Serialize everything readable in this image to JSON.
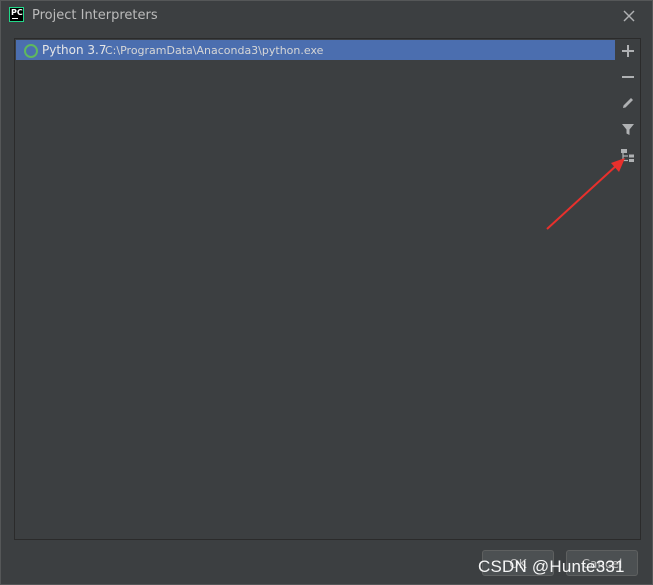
{
  "window": {
    "app_logo_text": "PC",
    "title": "Project Interpreters"
  },
  "interpreters": [
    {
      "name": "Python 3.7",
      "path": "C:\\ProgramData\\Anaconda3\\python.exe",
      "selected": true
    }
  ],
  "toolbar": {
    "icons": [
      "add-icon",
      "remove-icon",
      "edit-icon",
      "filter-icon",
      "show-paths-icon"
    ]
  },
  "footer": {
    "ok_label": "OK",
    "cancel_label": "Cancel"
  },
  "watermark": "CSDN @Hunte331",
  "colors": {
    "background": "#3c3f41",
    "selection": "#4b6eaf",
    "ring": "#5fb85f",
    "annotation": "#e8302c"
  }
}
